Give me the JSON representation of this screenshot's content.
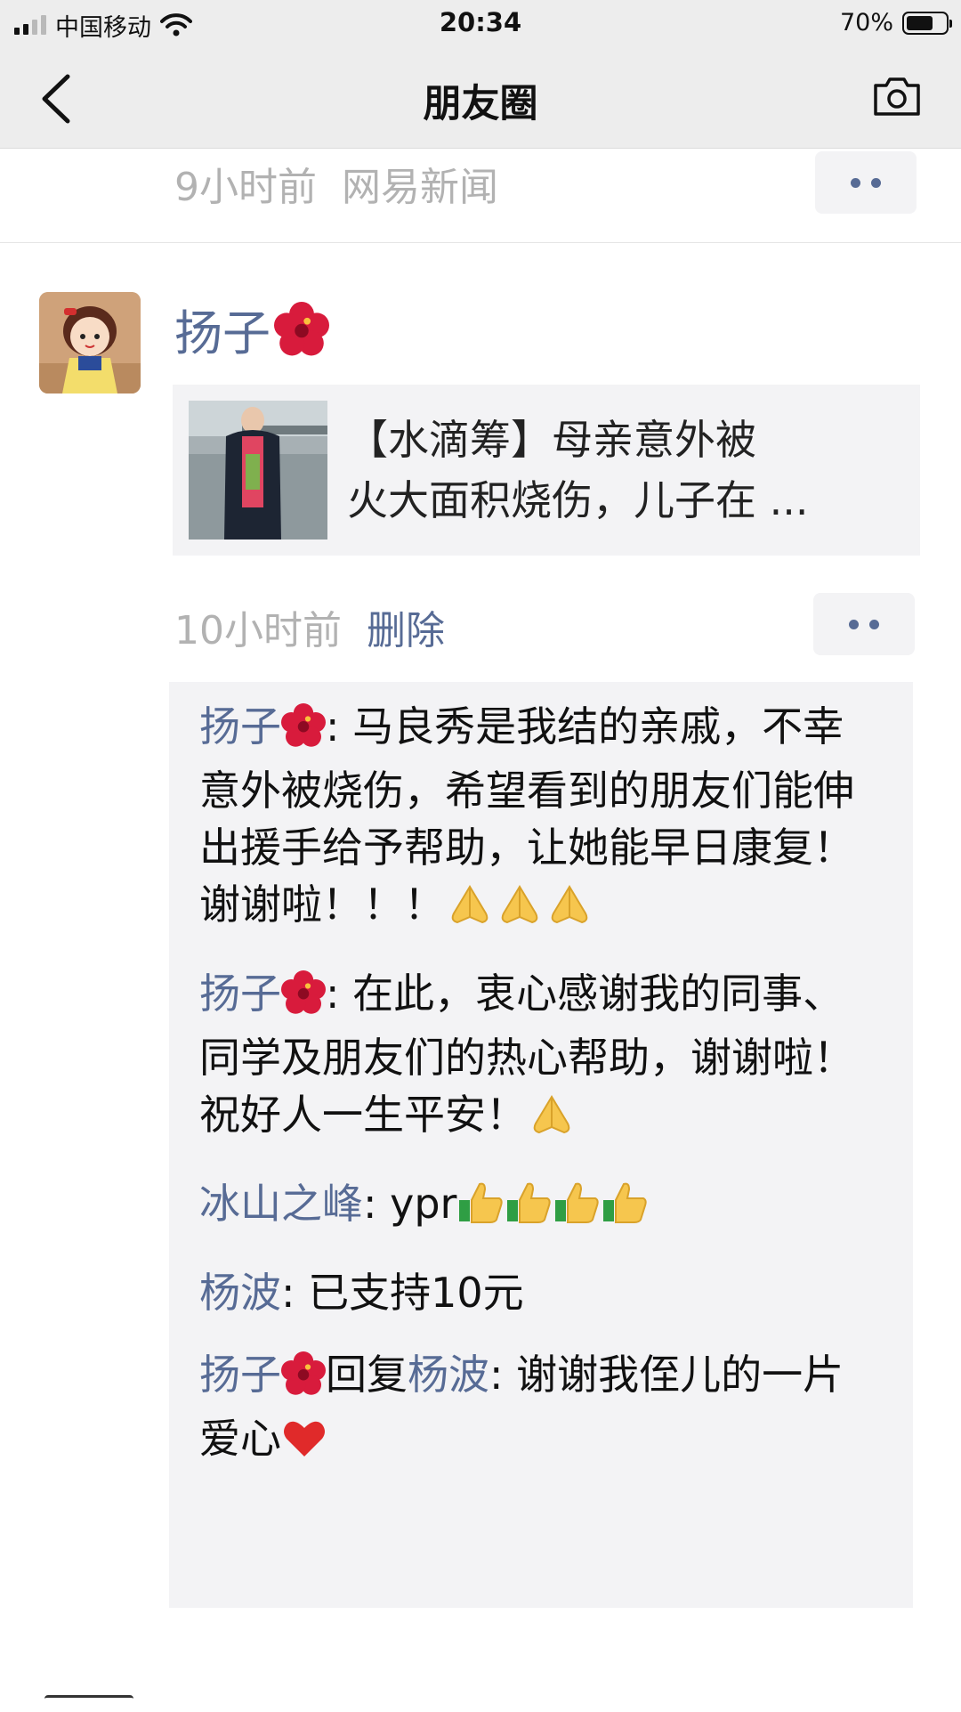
{
  "status_bar": {
    "carrier": "中国移动",
    "time": "20:34",
    "battery": "70%",
    "battery_level": 0.7
  },
  "nav": {
    "title": "朋友圈",
    "back_icon": "chevron-left-icon",
    "camera_icon": "camera-icon"
  },
  "previous_post": {
    "time_ago": "9小时前",
    "source": "网易新闻"
  },
  "post": {
    "author": "扬子",
    "author_emoji": "hibiscus-icon",
    "share": {
      "line1": "【水滴筹】母亲意外被",
      "line2": "火大面积烧伤，儿子在 ..."
    },
    "time_ago": "10小时前",
    "delete_label": "删除",
    "comments": [
      {
        "author": "扬子",
        "text": "马良秀是我结的亲戚，不幸意外被烧伤，希望看到的朋友们能伸出援手给予帮助，让她能早日康复！谢谢啦！！！",
        "emoji": "pray-icon",
        "emoji_count": 3
      },
      {
        "author": "扬子",
        "text": "在此，衷心感谢我的同事、同学及朋友们的热心帮助，谢谢啦！祝好人一生平安！",
        "emoji": "pray-icon",
        "emoji_count": 1
      },
      {
        "author": "冰山之峰",
        "text": "ypr",
        "emoji": "thumbs-up-icon",
        "emoji_count": 4
      },
      {
        "author": "杨波",
        "text": "已支持10元"
      },
      {
        "author": "扬子",
        "reply_word": "回复",
        "reply_to": "杨波",
        "text": "谢谢我侄儿的一片爱心",
        "emoji": "red-heart-icon",
        "emoji_count": 1
      }
    ]
  },
  "colors": {
    "link": "#576b95",
    "meta": "#b2b2b2",
    "panel": "#f3f3f5",
    "navbar": "#ededed"
  }
}
